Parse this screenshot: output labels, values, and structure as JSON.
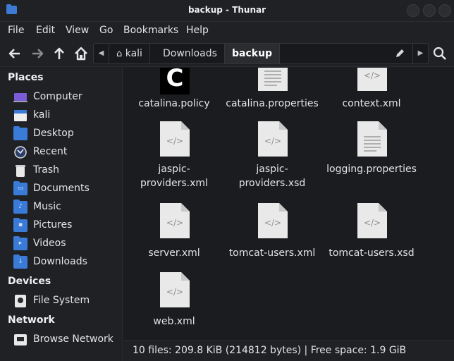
{
  "window": {
    "title": "backup - Thunar"
  },
  "menubar": {
    "items": [
      "File",
      "Edit",
      "View",
      "Go",
      "Bookmarks",
      "Help"
    ]
  },
  "pathbar": {
    "segments": [
      "kali",
      "Downloads",
      "backup"
    ],
    "active": "backup"
  },
  "sidebar": {
    "places_header": "Places",
    "places": [
      {
        "label": "Computer",
        "icon": "computer-icon"
      },
      {
        "label": "kali",
        "icon": "home-folder-icon"
      },
      {
        "label": "Desktop",
        "icon": "desktop-folder-icon"
      },
      {
        "label": "Recent",
        "icon": "recent-icon"
      },
      {
        "label": "Trash",
        "icon": "trash-icon"
      },
      {
        "label": "Documents",
        "icon": "documents-folder-icon"
      },
      {
        "label": "Music",
        "icon": "music-folder-icon"
      },
      {
        "label": "Pictures",
        "icon": "pictures-folder-icon"
      },
      {
        "label": "Videos",
        "icon": "videos-folder-icon"
      },
      {
        "label": "Downloads",
        "icon": "downloads-folder-icon"
      }
    ],
    "devices_header": "Devices",
    "devices": [
      {
        "label": "File System",
        "icon": "drive-icon"
      }
    ],
    "network_header": "Network",
    "network": [
      {
        "label": "Browse Network",
        "icon": "network-icon"
      }
    ]
  },
  "files": [
    {
      "name_lines": [
        "catalina.policy"
      ],
      "type": "policy"
    },
    {
      "name_lines": [
        "catalina.properties"
      ],
      "type": "text"
    },
    {
      "name_lines": [
        "context.xml"
      ],
      "type": "xml"
    },
    {
      "name_lines": [
        "jaspic-",
        "providers.xml"
      ],
      "type": "xml"
    },
    {
      "name_lines": [
        "jaspic-",
        "providers.xsd"
      ],
      "type": "xml"
    },
    {
      "name_lines": [
        "logging.properties"
      ],
      "type": "text"
    },
    {
      "name_lines": [
        "server.xml"
      ],
      "type": "xml"
    },
    {
      "name_lines": [
        "tomcat-users.xml"
      ],
      "type": "xml"
    },
    {
      "name_lines": [
        "tomcat-users.xsd"
      ],
      "type": "xml"
    },
    {
      "name_lines": [
        "web.xml"
      ],
      "type": "xml"
    }
  ],
  "status": {
    "text": "10 files: 209.8 KiB (214812 bytes)  |  Free space: 1.9 GiB"
  },
  "colors": {
    "accent": "#3a7bd8",
    "background": "#1a1c1f",
    "doc_page": "#e9e9e9"
  }
}
